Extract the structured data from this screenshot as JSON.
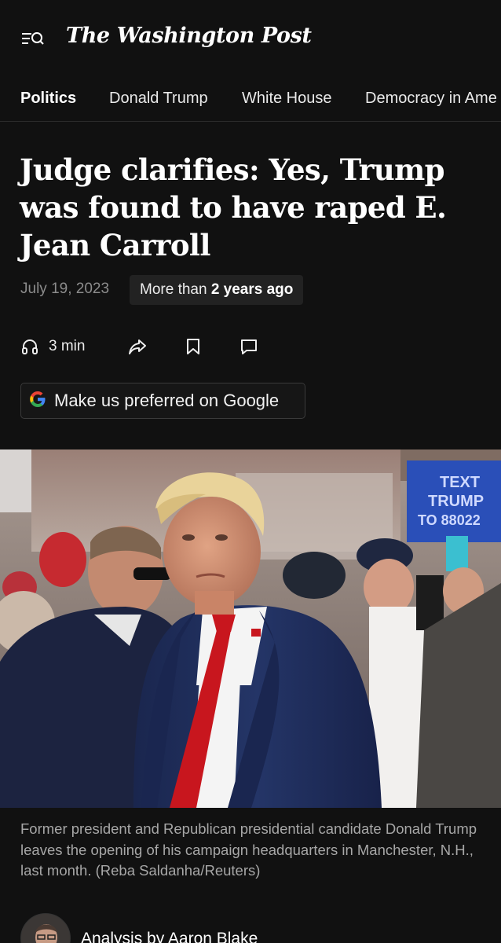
{
  "header": {
    "menu_icon": "menu-search-icon",
    "logo_text": "The Washington Post"
  },
  "nav": {
    "items": [
      {
        "label": "Politics",
        "active": true
      },
      {
        "label": "Donald Trump",
        "active": false
      },
      {
        "label": "White House",
        "active": false
      },
      {
        "label": "Democracy in Ame",
        "active": false
      }
    ]
  },
  "article": {
    "headline": "Judge clarifies: Yes, Trump was found to have raped E. Jean Carroll",
    "date": "July 19, 2023",
    "age_prefix": "More than",
    "age_bold": "2 years ago",
    "listen_label": "3 min",
    "google_button_label": "Make us preferred on Google",
    "caption": "Former president and Republican presidential candidate Donald Trump leaves the opening of his campaign headquarters in Manchester, N.H., last month. (Reba Saldanha/Reuters)",
    "byline_prefix": "Analysis by ",
    "byline_author": "Aaron Blake"
  },
  "photo": {
    "sign_lines": [
      "TEXT",
      "TRUMP",
      "TO 88022"
    ]
  },
  "colors": {
    "background": "#111111",
    "text": "#ffffff",
    "muted": "#8c8c8c",
    "badge_bg": "#222222",
    "tie_red": "#c8161e",
    "suit_navy": "#1e2d5c"
  }
}
